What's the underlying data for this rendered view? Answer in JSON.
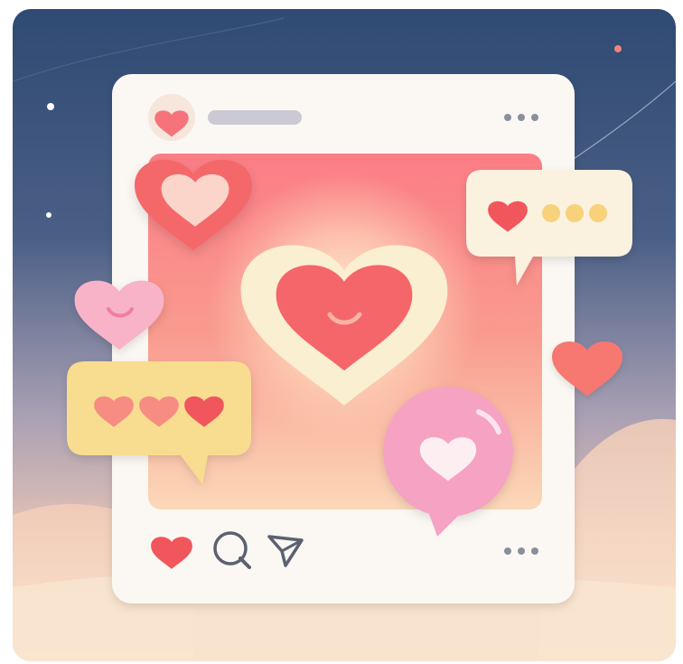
{
  "illustration": {
    "colors": {
      "sky_top": "#2f4a73",
      "sky_mid": "#8e8fa8",
      "sky_bottom": "#f1cfb4",
      "card": "#fbf8f3",
      "photo_top": "#fb7d86",
      "photo_bottom": "#fbd3b3",
      "heart_red": "#f0565c",
      "heart_coral": "#f6786f",
      "heart_pink": "#f8b3c8",
      "cream": "#faf0dd",
      "bubble_yellow": "#f8dd90",
      "bubble_pink": "#f5a2c3"
    },
    "post": {
      "avatar_icon": "heart-icon",
      "more_icon": "ellipsis-icon"
    },
    "actions": {
      "like_icon": "heart-icon",
      "comment_icon": "speech-bubble-icon",
      "share_icon": "paper-plane-icon",
      "more_icon": "ellipsis-icon"
    },
    "floating": {
      "red_heart_icon": "heart-icon",
      "smiley_pink_heart_icon": "smiley-heart-icon",
      "coral_heart_icon": "heart-icon",
      "yellow_bubble_icons": [
        "heart-icon",
        "heart-icon",
        "heart-icon"
      ],
      "cream_bubble_icons": [
        "heart-icon",
        "dot-icon",
        "dot-icon",
        "dot-icon"
      ],
      "pink_bubble_icon": "heart-icon",
      "center_heart_icon": "smiley-heart-icon"
    }
  }
}
